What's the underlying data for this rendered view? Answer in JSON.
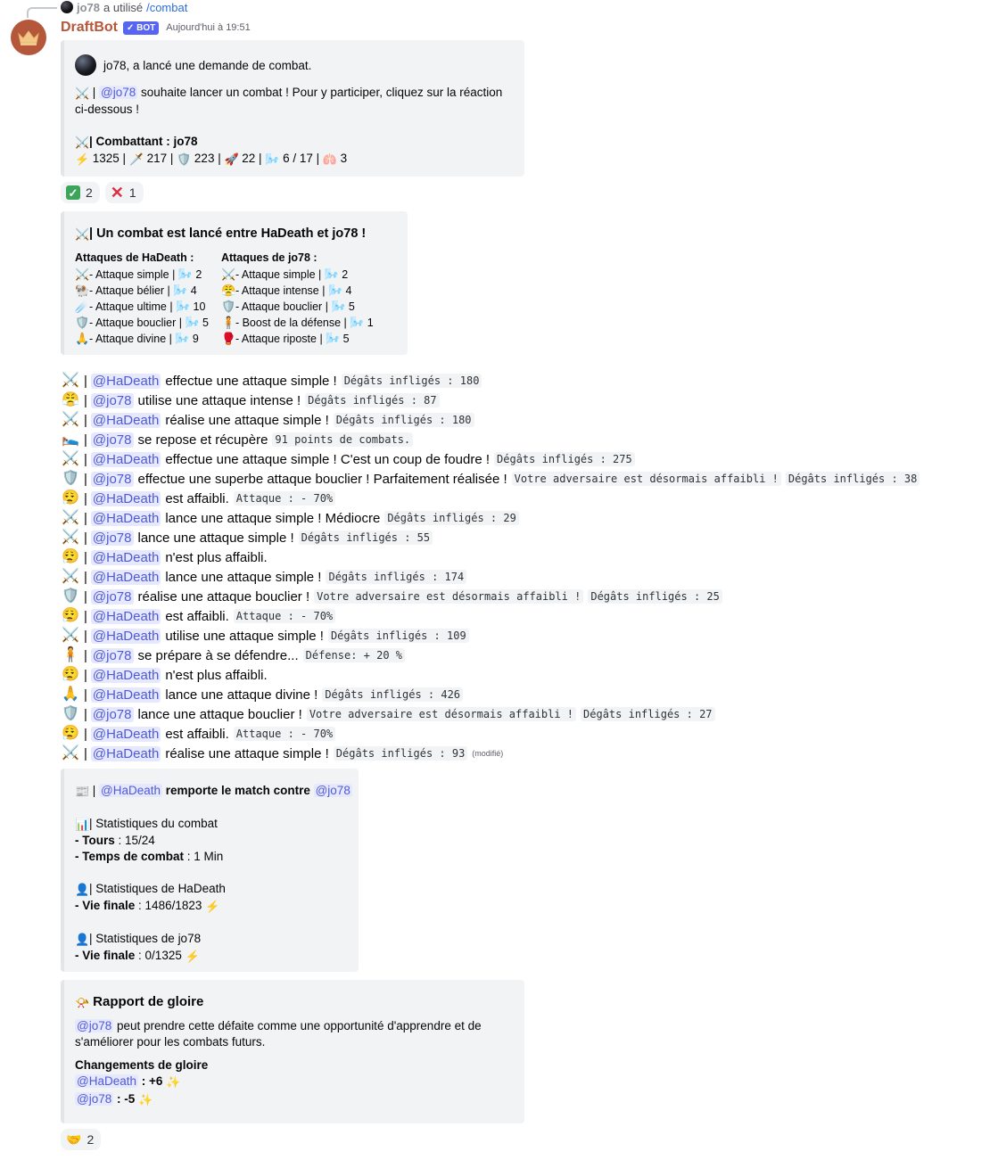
{
  "reply": {
    "username": "jo78",
    "used_text": "a utilisé",
    "command": "/combat"
  },
  "header": {
    "bot_name": "DraftBot",
    "badge": "✓ BOT",
    "timestamp": "Aujourd'hui à 19:51"
  },
  "embed1": {
    "author": "jo78, a lancé une demande de combat.",
    "line1_icon": "⚔️",
    "line1_sep": "|",
    "line1_mention": "@jo78",
    "line1_text": "souhaite lancer un combat ! Pour y participer, cliquez sur la réaction",
    "line1_text2": "ci-dessous !",
    "fighter_icon": "⚔️",
    "fighter_label": "| Combattant : jo78",
    "stats": [
      {
        "icon": "⚡",
        "value": "1325 |"
      },
      {
        "icon": "🗡️",
        "value": "217 |"
      },
      {
        "icon": "🛡️",
        "value": "223 |"
      },
      {
        "icon": "🚀",
        "value": "22 |"
      },
      {
        "icon": "🌬️",
        "value": "6 / 17 |"
      },
      {
        "icon": "🫁",
        "value": "3"
      }
    ]
  },
  "reactions1": [
    {
      "count": "2"
    },
    {
      "count": "1"
    }
  ],
  "embed2": {
    "title": "| Un combat est lancé entre HaDeath et jo78 !",
    "col1": {
      "header": "Attaques de HaDeath :",
      "rows": [
        {
          "icon": "⚔️",
          "text": "- Attaque simple |",
          "cost": "2"
        },
        {
          "icon": "🐏",
          "text": "- Attaque bélier |",
          "cost": "4"
        },
        {
          "icon": "☄️",
          "text": "- Attaque ultime |",
          "cost": "10"
        },
        {
          "icon": "🛡️",
          "text": "- Attaque bouclier |",
          "cost": "5"
        },
        {
          "icon": "🙏",
          "text": "- Attaque divine |",
          "cost": "9"
        }
      ]
    },
    "col2": {
      "header": "Attaques de jo78 :",
      "rows": [
        {
          "icon": "⚔️",
          "text": "- Attaque simple |",
          "cost": "2"
        },
        {
          "icon": "😤",
          "text": "- Attaque intense |",
          "cost": "4"
        },
        {
          "icon": "🛡️",
          "text": "- Attaque bouclier |",
          "cost": "5"
        },
        {
          "icon": "🧍",
          "text": "- Boost de la défense |",
          "cost": "1"
        },
        {
          "icon": "🥊",
          "text": "- Attaque riposte |",
          "cost": "5"
        }
      ]
    }
  },
  "log": [
    {
      "icon": "⚔️",
      "mention": "@HaDeath",
      "text": "effectue une attaque simple !",
      "codes": [
        "Dégâts infligés : 180"
      ]
    },
    {
      "icon": "😤",
      "mention": "@jo78",
      "text": "utilise une attaque intense !",
      "codes": [
        "Dégâts infligés : 87"
      ]
    },
    {
      "icon": "⚔️",
      "mention": "@HaDeath",
      "text": "réalise une attaque simple !",
      "codes": [
        "Dégâts infligés : 180"
      ]
    },
    {
      "icon": "🛌",
      "mention": "@jo78",
      "text": "se repose et récupère",
      "codes": [
        "91 points de combats."
      ]
    },
    {
      "icon": "⚔️",
      "mention": "@HaDeath",
      "text": "effectue une attaque simple ! C'est un coup de foudre !",
      "codes": [
        "Dégâts infligés : 275"
      ]
    },
    {
      "icon": "🛡️",
      "mention": "@jo78",
      "text": "effectue une superbe attaque bouclier ! Parfaitement réalisée !",
      "codes": [
        "Votre adversaire est désormais affaibli !",
        "Dégâts infligés : 38"
      ]
    },
    {
      "icon": "😮‍💨",
      "mention": "@HaDeath",
      "text": "est affaibli.",
      "codes": [
        "Attaque : - 70%"
      ]
    },
    {
      "icon": "⚔️",
      "mention": "@HaDeath",
      "text": "lance une attaque simple ! Médiocre",
      "codes": [
        "Dégâts infligés : 29"
      ]
    },
    {
      "icon": "⚔️",
      "mention": "@jo78",
      "text": "lance une attaque simple !",
      "codes": [
        "Dégâts infligés : 55"
      ]
    },
    {
      "icon": "😮‍💨",
      "mention": "@HaDeath",
      "text": "n'est plus affaibli.",
      "codes": []
    },
    {
      "icon": "⚔️",
      "mention": "@HaDeath",
      "text": "lance une attaque simple !",
      "codes": [
        "Dégâts infligés : 174"
      ]
    },
    {
      "icon": "🛡️",
      "mention": "@jo78",
      "text": "réalise une attaque bouclier !",
      "codes": [
        "Votre adversaire est désormais affaibli !",
        "Dégâts infligés : 25"
      ]
    },
    {
      "icon": "😮‍💨",
      "mention": "@HaDeath",
      "text": "est affaibli.",
      "codes": [
        "Attaque : - 70%"
      ]
    },
    {
      "icon": "⚔️",
      "mention": "@HaDeath",
      "text": "utilise une attaque simple !",
      "codes": [
        "Dégâts infligés : 109"
      ]
    },
    {
      "icon": "🧍",
      "mention": "@jo78",
      "text": "se prépare à se défendre...",
      "codes": [
        "Défense: + 20 %"
      ]
    },
    {
      "icon": "😮‍💨",
      "mention": "@HaDeath",
      "text": "n'est plus affaibli.",
      "codes": []
    },
    {
      "icon": "🙏",
      "mention": "@HaDeath",
      "text": "lance une attaque divine !",
      "codes": [
        "Dégâts infligés : 426"
      ]
    },
    {
      "icon": "🛡️",
      "mention": "@jo78",
      "text": "lance une attaque bouclier !",
      "codes": [
        "Votre adversaire est désormais affaibli !",
        "Dégâts infligés : 27"
      ]
    },
    {
      "icon": "😮‍💨",
      "mention": "@HaDeath",
      "text": "est affaibli.",
      "codes": [
        "Attaque : - 70%"
      ]
    },
    {
      "icon": "⚔️",
      "mention": "@HaDeath",
      "text": "réalise une attaque simple !",
      "codes": [
        "Dégâts infligés : 93"
      ],
      "edited": "(modifié)"
    }
  ],
  "embed3": {
    "winner_icon": "📰",
    "winner_mention": "@HaDeath",
    "winner_text": "remporte le match contre",
    "loser_mention": "@jo78",
    "stats_title_icon": "📊",
    "stats_title": "| Statistiques du combat",
    "turns_label": "- Tours",
    "turns_value": ": 15/24",
    "time_label": "- Temps de combat",
    "time_value": ": 1 Min",
    "p1_icon": "👤",
    "p1_title": "| Statistiques de HaDeath",
    "p1_life_label": "- Vie finale",
    "p1_life_value": ": 1486/1823",
    "p2_icon": "👤",
    "p2_title": "| Statistiques de jo78",
    "p2_life_label": "- Vie finale",
    "p2_life_value": ": 0/1325"
  },
  "embed4": {
    "icon": "📯",
    "title": "Rapport de gloire",
    "mention": "@jo78",
    "desc1": "peut prendre cette défaite comme une opportunité d'apprendre et de",
    "desc2": "s'améliorer pour les combats futurs.",
    "changes_title": "Changements de gloire",
    "change1_mention": "@HaDeath",
    "change1_value": ": +6",
    "change2_mention": "@jo78",
    "change2_value": ": -5"
  },
  "reactions2": [
    {
      "icon": "🤝",
      "count": "2"
    }
  ],
  "colors": {
    "brand": "#b5573a",
    "badge": "#5865f2",
    "mention_bg": "#e6e8fd",
    "mention_fg": "#4f5bd5",
    "embed_bg": "#f2f3f5"
  }
}
